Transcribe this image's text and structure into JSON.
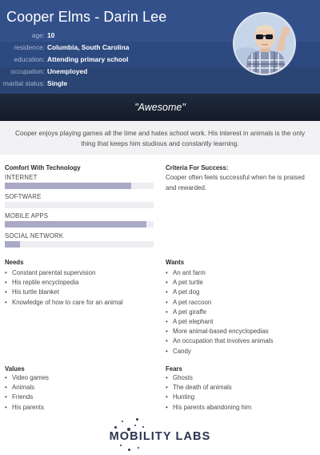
{
  "persona": {
    "name": "Cooper Elms - Darin Lee",
    "facts": [
      {
        "key": "age:",
        "value": "10"
      },
      {
        "key": "residence:",
        "value": "Columbia, South Carolina"
      },
      {
        "key": "education:",
        "value": "Attending primary school"
      },
      {
        "key": "occupation:",
        "value": "Unemployed"
      },
      {
        "key": "marital status:",
        "value": "Single"
      }
    ],
    "quote": "\"Awesome\"",
    "intro": "Cooper enjoys playing games all the time and hates school work. His interest in animals is the only thing that keeps him studious and constantly learning."
  },
  "comfort": {
    "title": "Comfort With Technology",
    "items": [
      {
        "label": "INTERNET",
        "level": 0.85
      },
      {
        "label": "SOFTWARE",
        "level": 0.0
      },
      {
        "label": "MOBILE APPS",
        "level": 0.95
      },
      {
        "label": "SOCIAL NETWORK",
        "level": 0.1
      }
    ]
  },
  "criteria": {
    "title": "Criteria For Success:",
    "text": "Cooper often feels successful when he is praised and rewarded."
  },
  "needs": {
    "title": "Needs",
    "items": [
      "Constant parental supervision",
      "His reptile encyclopedia",
      "His turtle blanket",
      "Knowledge of how to care for an animal"
    ]
  },
  "wants": {
    "title": "Wants",
    "items": [
      "An ant farm",
      "A pet turtle",
      "A pet dog",
      "A pet raccoon",
      "A pet giraffe",
      "A pet elephant",
      "More animal-based encyclopedias",
      "An occupation that involves animals",
      "Candy"
    ]
  },
  "values": {
    "title": "Values",
    "items": [
      "Video games",
      "Animals",
      "Friends",
      "His parents"
    ]
  },
  "fears": {
    "title": "Fears",
    "items": [
      "Ghosts",
      "The death of animals",
      "Hunting",
      "His parents abandoning him"
    ]
  },
  "logo": {
    "text": "MOBILITY LABS"
  },
  "colors": {
    "header": "#2f4b7c",
    "quote_band": "#1a2332",
    "bar_fill": "#a9a9c6",
    "bar_track": "#eeeef2",
    "logo": "#2a3552"
  }
}
